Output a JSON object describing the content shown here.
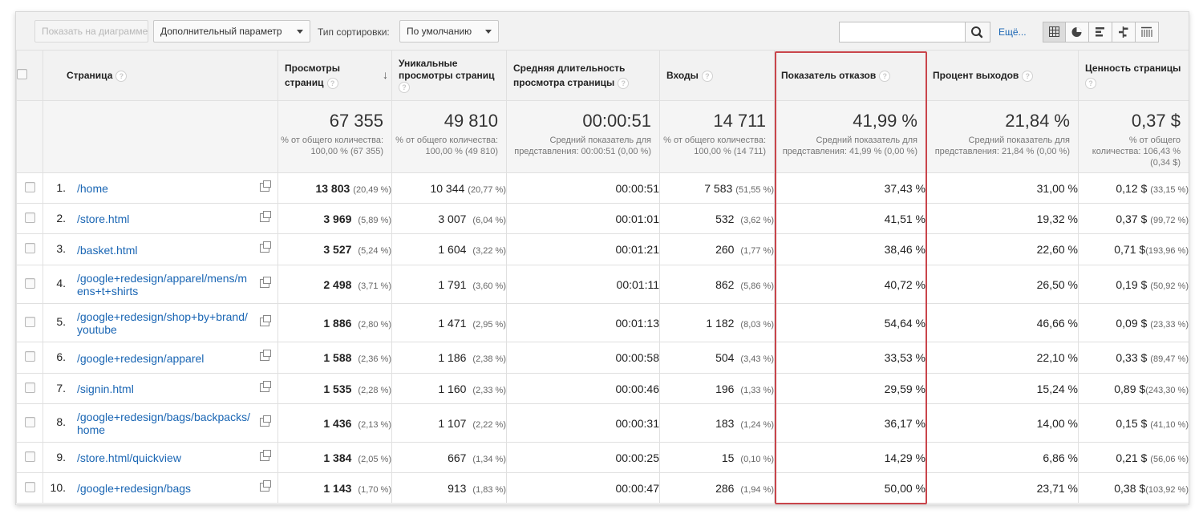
{
  "toolbar": {
    "show_chart_label": "Показать на диаграмме",
    "extra_param_label": "Дополнительный параметр",
    "sort_type_label": "Тип сортировки:",
    "sort_default_label": "По умолчанию",
    "search_value": "",
    "more_label": "Ещё..."
  },
  "columns": {
    "page": "Страница",
    "pageviews": "Просмотры страниц",
    "unique": "Уникальные просмотры страниц",
    "avg_time": "Средняя длительность просмотра страницы",
    "entrances": "Входы",
    "bounce": "Показатель отказов",
    "exit": "Процент выходов",
    "value": "Ценность страницы"
  },
  "totals": {
    "pageviews": "67 355",
    "pageviews_sub": "% от общего количества: 100,00 % (67 355)",
    "unique": "49 810",
    "unique_sub": "% от общего количества: 100,00 % (49 810)",
    "avg_time": "00:00:51",
    "avg_time_sub": "Средний показатель для представления: 00:00:51 (0,00 %)",
    "entrances": "14 711",
    "entrances_sub": "% от общего количества: 100,00 % (14 711)",
    "bounce": "41,99 %",
    "bounce_sub": "Средний показатель для представления: 41,99 % (0,00 %)",
    "exit": "21,84 %",
    "exit_sub": "Средний показатель для представления: 21,84 % (0,00 %)",
    "value": "0,37 $",
    "value_sub": "% от общего количества: 106,43 % (0,34 $)"
  },
  "rows": [
    {
      "idx": "1.",
      "page": "/home",
      "pv": "13 803",
      "pv_pct": "(20,49 %)",
      "uv": "10 344",
      "uv_pct": "(20,77 %)",
      "time": "00:00:51",
      "ent": "7 583",
      "ent_pct": "(51,55 %)",
      "bounce": "37,43 %",
      "exit": "31,00 %",
      "val": "0,12 $",
      "val_pct": "(33,15 %)"
    },
    {
      "idx": "2.",
      "page": "/store.html",
      "pv": "3 969",
      "pv_pct": "(5,89 %)",
      "uv": "3 007",
      "uv_pct": "(6,04 %)",
      "time": "00:01:01",
      "ent": "532",
      "ent_pct": "(3,62 %)",
      "bounce": "41,51 %",
      "exit": "19,32 %",
      "val": "0,37 $",
      "val_pct": "(99,72 %)"
    },
    {
      "idx": "3.",
      "page": "/basket.html",
      "pv": "3 527",
      "pv_pct": "(5,24 %)",
      "uv": "1 604",
      "uv_pct": "(3,22 %)",
      "time": "00:01:21",
      "ent": "260",
      "ent_pct": "(1,77 %)",
      "bounce": "38,46 %",
      "exit": "22,60 %",
      "val": "0,71 $",
      "val_pct": "(193,96 %)"
    },
    {
      "idx": "4.",
      "page": "/google+redesign/apparel/mens/mens+t+shirts",
      "pv": "2 498",
      "pv_pct": "(3,71 %)",
      "uv": "1 791",
      "uv_pct": "(3,60 %)",
      "time": "00:01:11",
      "ent": "862",
      "ent_pct": "(5,86 %)",
      "bounce": "40,72 %",
      "exit": "26,50 %",
      "val": "0,19 $",
      "val_pct": "(50,92 %)"
    },
    {
      "idx": "5.",
      "page": "/google+redesign/shop+by+brand/youtube",
      "pv": "1 886",
      "pv_pct": "(2,80 %)",
      "uv": "1 471",
      "uv_pct": "(2,95 %)",
      "time": "00:01:13",
      "ent": "1 182",
      "ent_pct": "(8,03 %)",
      "bounce": "54,64 %",
      "exit": "46,66 %",
      "val": "0,09 $",
      "val_pct": "(23,33 %)"
    },
    {
      "idx": "6.",
      "page": "/google+redesign/apparel",
      "pv": "1 588",
      "pv_pct": "(2,36 %)",
      "uv": "1 186",
      "uv_pct": "(2,38 %)",
      "time": "00:00:58",
      "ent": "504",
      "ent_pct": "(3,43 %)",
      "bounce": "33,53 %",
      "exit": "22,10 %",
      "val": "0,33 $",
      "val_pct": "(89,47 %)"
    },
    {
      "idx": "7.",
      "page": "/signin.html",
      "pv": "1 535",
      "pv_pct": "(2,28 %)",
      "uv": "1 160",
      "uv_pct": "(2,33 %)",
      "time": "00:00:46",
      "ent": "196",
      "ent_pct": "(1,33 %)",
      "bounce": "29,59 %",
      "exit": "15,24 %",
      "val": "0,89 $",
      "val_pct": "(243,30 %)"
    },
    {
      "idx": "8.",
      "page": "/google+redesign/bags/backpacks/home",
      "pv": "1 436",
      "pv_pct": "(2,13 %)",
      "uv": "1 107",
      "uv_pct": "(2,22 %)",
      "time": "00:00:31",
      "ent": "183",
      "ent_pct": "(1,24 %)",
      "bounce": "36,17 %",
      "exit": "14,00 %",
      "val": "0,15 $",
      "val_pct": "(41,10 %)"
    },
    {
      "idx": "9.",
      "page": "/store.html/quickview",
      "pv": "1 384",
      "pv_pct": "(2,05 %)",
      "uv": "667",
      "uv_pct": "(1,34 %)",
      "time": "00:00:25",
      "ent": "15",
      "ent_pct": "(0,10 %)",
      "bounce": "14,29 %",
      "exit": "6,86 %",
      "val": "0,21 $",
      "val_pct": "(56,06 %)"
    },
    {
      "idx": "10.",
      "page": "/google+redesign/bags",
      "pv": "1 143",
      "pv_pct": "(1,70 %)",
      "uv": "913",
      "uv_pct": "(1,83 %)",
      "time": "00:00:47",
      "ent": "286",
      "ent_pct": "(1,94 %)",
      "bounce": "50,00 %",
      "exit": "23,71 %",
      "val": "0,38 $",
      "val_pct": "(103,92 %)"
    }
  ],
  "colors": {
    "link": "#1a66b4",
    "highlight": "#c9454b",
    "header_bg": "#f2f2f2"
  },
  "icons": {
    "help": "question-circle-icon",
    "sort": "arrow-down-icon",
    "search": "magnifier-icon",
    "open_page": "external-link-icon",
    "views": [
      "table-view-icon",
      "pie-view-icon",
      "bar-view-icon",
      "comparison-view-icon",
      "pivot-view-icon"
    ]
  }
}
